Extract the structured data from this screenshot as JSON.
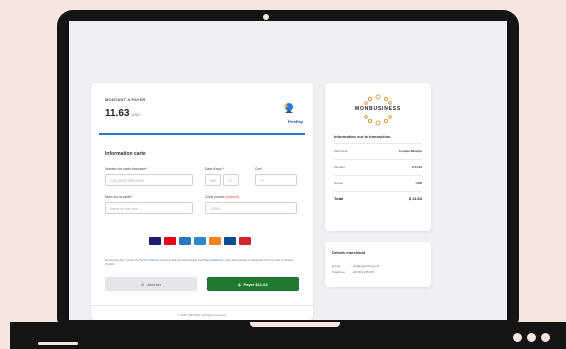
{
  "payment": {
    "amount_label": "MONTANT A PAYER",
    "amount": "11.63",
    "currency": "USD",
    "brand": "FlexPay",
    "section_title": "Information carte",
    "card_number_label": "Numéro de carte bancaire*",
    "card_number_placeholder": "1234 5678 9000 0000",
    "expiry_label": "Date d'exp.*",
    "expiry_month_placeholder": "MM",
    "expiry_year_placeholder": "YY",
    "cvv_label": "Cvv*",
    "cvv_placeholder": "***",
    "name_label": "Nom sur la carte*",
    "name_placeholder": "Name on the card",
    "postal_label": "Code postal",
    "postal_optional": "(optionel)",
    "postal_placeholder": "12345",
    "policy_prefix": "By selecting Pay, I accept the",
    "policy_terms": "Terms of Service",
    "policy_mid": "and have read and acknowledge the",
    "policy_privacy": "Privacy Statement",
    "policy_suffix": ". I also allow Flexpay to charge $11.63 to my card on October 25,2022.",
    "cancel_label": "Annuler",
    "pay_label": "Payer $11.63",
    "footer": "© 2022 INFOSET. All rights reserved."
  },
  "card_brands": [
    {
      "name": "visa-logo",
      "color": "#1a1f71"
    },
    {
      "name": "mastercard-logo",
      "color": "#eb001b"
    },
    {
      "name": "amex-logo",
      "color": "#2e77bc"
    },
    {
      "name": "unionpay-logo",
      "color": "#2b8bd0"
    },
    {
      "name": "discover-logo",
      "color": "#f58220"
    },
    {
      "name": "jcb-logo",
      "color": "#0e4c96"
    },
    {
      "name": "diners-logo",
      "color": "#d22630"
    }
  ],
  "transaction": {
    "logo_text": "MONBUSINESS",
    "title": "Information sur la transaction",
    "rows": [
      {
        "key": "Marchand",
        "value": "Compte Mmetye"
      },
      {
        "key": "Montant",
        "value": "$ 11.63"
      },
      {
        "key": "Devise",
        "value": "USD"
      }
    ],
    "total_label": "Total",
    "total_value": "$ 11.63"
  },
  "merchant": {
    "title": "Détails marchand",
    "email_label": "E-mail",
    "email_value": "info@mgcetimeye.cd",
    "phone_label": "Telephone",
    "phone_value": "243 812 345 678"
  },
  "colors": {
    "background": "#f6e6df",
    "accent": "#2e77d0",
    "pay_button": "#1f7a30"
  }
}
